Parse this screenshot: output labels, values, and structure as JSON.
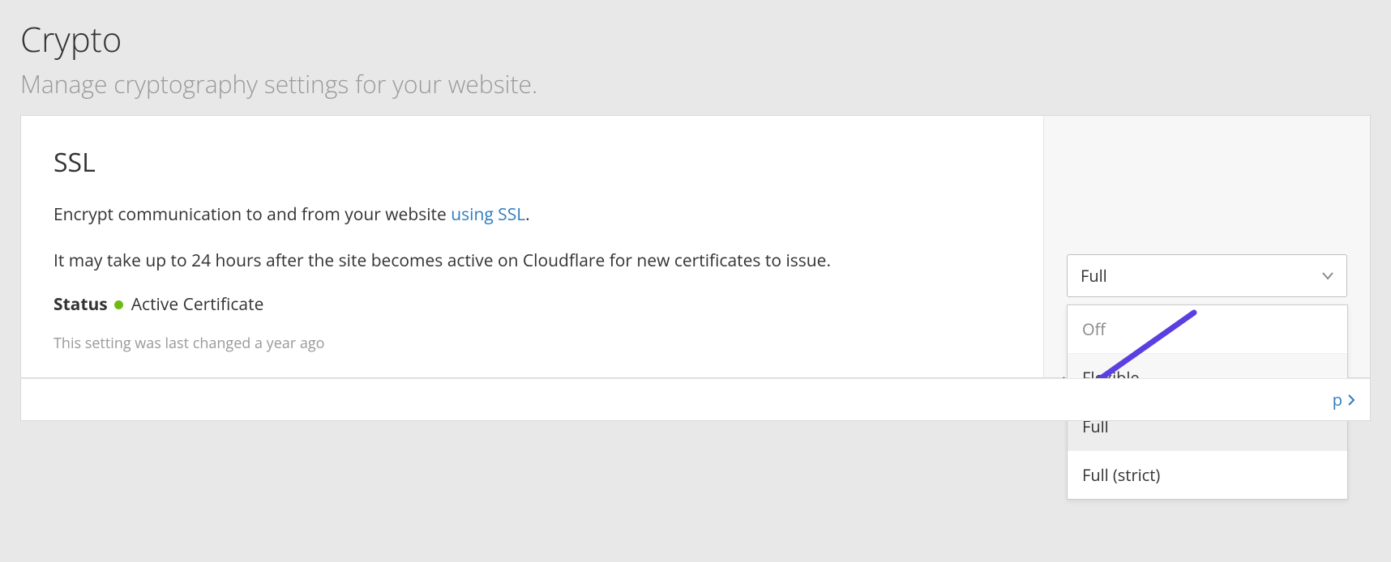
{
  "header": {
    "title": "Crypto",
    "subtitle": "Manage cryptography settings for your website."
  },
  "ssl": {
    "title": "SSL",
    "desc_prefix": "Encrypt communication to and from your website ",
    "desc_link": "using SSL",
    "desc_suffix": ".",
    "note": "It may take up to 24 hours after the site becomes active on Cloudflare for new certificates to issue.",
    "status_label": "Status",
    "status_value": "Active Certificate",
    "status_color": "#6fbb13",
    "last_changed": "This setting was last changed a year ago",
    "selected": "Full",
    "options": [
      "Off",
      "Flexible",
      "Full",
      "Full (strict)"
    ]
  },
  "footer": {
    "help_label_suffix": "p"
  },
  "annotation": {
    "arrow_color": "#5b3fe0"
  }
}
